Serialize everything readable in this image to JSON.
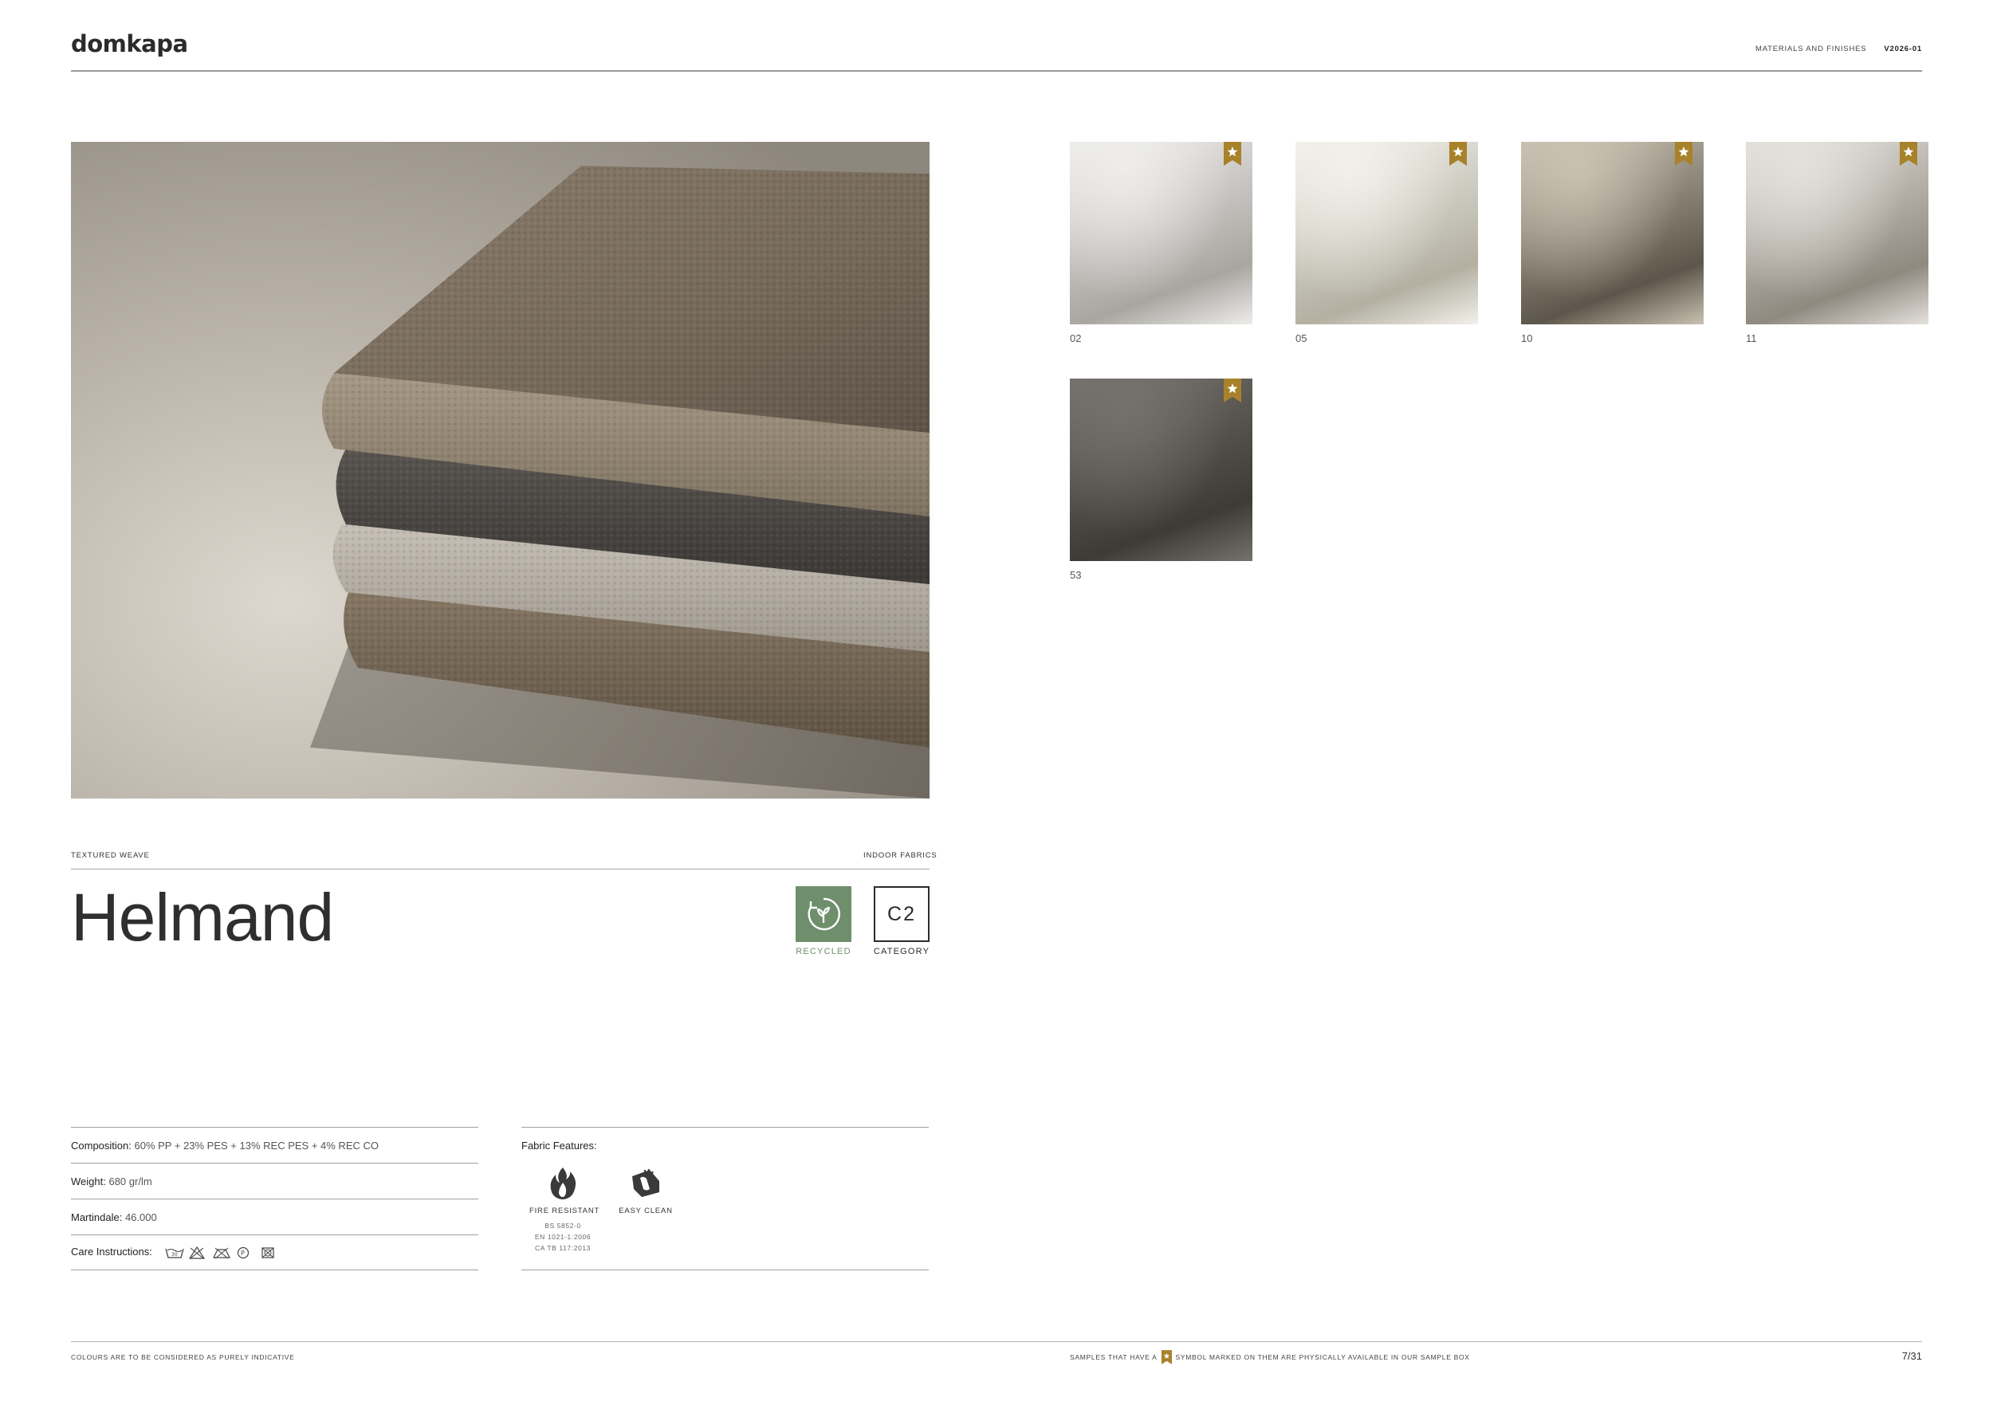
{
  "header": {
    "brand": "domkapa",
    "section": "MATERIALS AND FINISHES",
    "version": "V2026-01"
  },
  "hero": {
    "alt": "Stack of folded textured weave fabrics",
    "colors": [
      "#7a6d5f",
      "#4a4744",
      "#bab3aa",
      "#7a6a58"
    ]
  },
  "product": {
    "type": "TEXTURED WEAVE",
    "category_line": "INDOOR FABRICS",
    "name": "Helmand",
    "recycled_label": "RECYCLED",
    "category_code": "C2",
    "category_label": "CATEGORY",
    "recycled_color": "#6f8f6c"
  },
  "specs": {
    "composition_label": "Composition:",
    "composition_value": "60% PP + 23% PES + 13% REC PES + 4% REC CO",
    "weight_label": "Weight:",
    "weight_value": "680 gr/lm",
    "martindale_label": "Martindale:",
    "martindale_value": "46.000",
    "care_label": "Care Instructions:",
    "care_icons": [
      "wash-30-icon",
      "no-bleach-icon",
      "no-tumble-dry-icon",
      "dry-clean-p-icon",
      "no-iron-icon"
    ]
  },
  "features": {
    "title": "Fabric Features:",
    "items": [
      {
        "icon": "flame-icon",
        "name": "FIRE RESISTANT",
        "norms": [
          "BS 5852-0",
          "EN 1021-1:2006",
          "CA TB 117:2013"
        ]
      },
      {
        "icon": "easy-clean-icon",
        "name": "EASY CLEAN",
        "norms": []
      }
    ]
  },
  "swatches": [
    {
      "code": "02",
      "in_sample_box": true,
      "color_light": "#eeedeb",
      "color_dark": "#a9a6a1"
    },
    {
      "code": "05",
      "in_sample_box": true,
      "color_light": "#f2f0ea",
      "color_dark": "#b3b0a2"
    },
    {
      "code": "10",
      "in_sample_box": true,
      "color_light": "#c9c2b2",
      "color_dark": "#5d564a"
    },
    {
      "code": "11",
      "in_sample_box": true,
      "color_light": "#e4e1dc",
      "color_dark": "#8f8a80"
    },
    {
      "code": "53",
      "in_sample_box": true,
      "color_light": "#75716d",
      "color_dark": "#3e3a36"
    }
  ],
  "footer": {
    "disclaimer": "COLOURS ARE TO BE CONSIDERED AS PURELY INDICATIVE",
    "sample_note_before": "SAMPLES THAT HAVE A",
    "sample_note_after": "SYMBOL MARKED ON THEM ARE PHYSICALLY AVAILABLE IN OUR SAMPLE BOX",
    "page": "7/31"
  },
  "accent_gold": "#a8822a"
}
